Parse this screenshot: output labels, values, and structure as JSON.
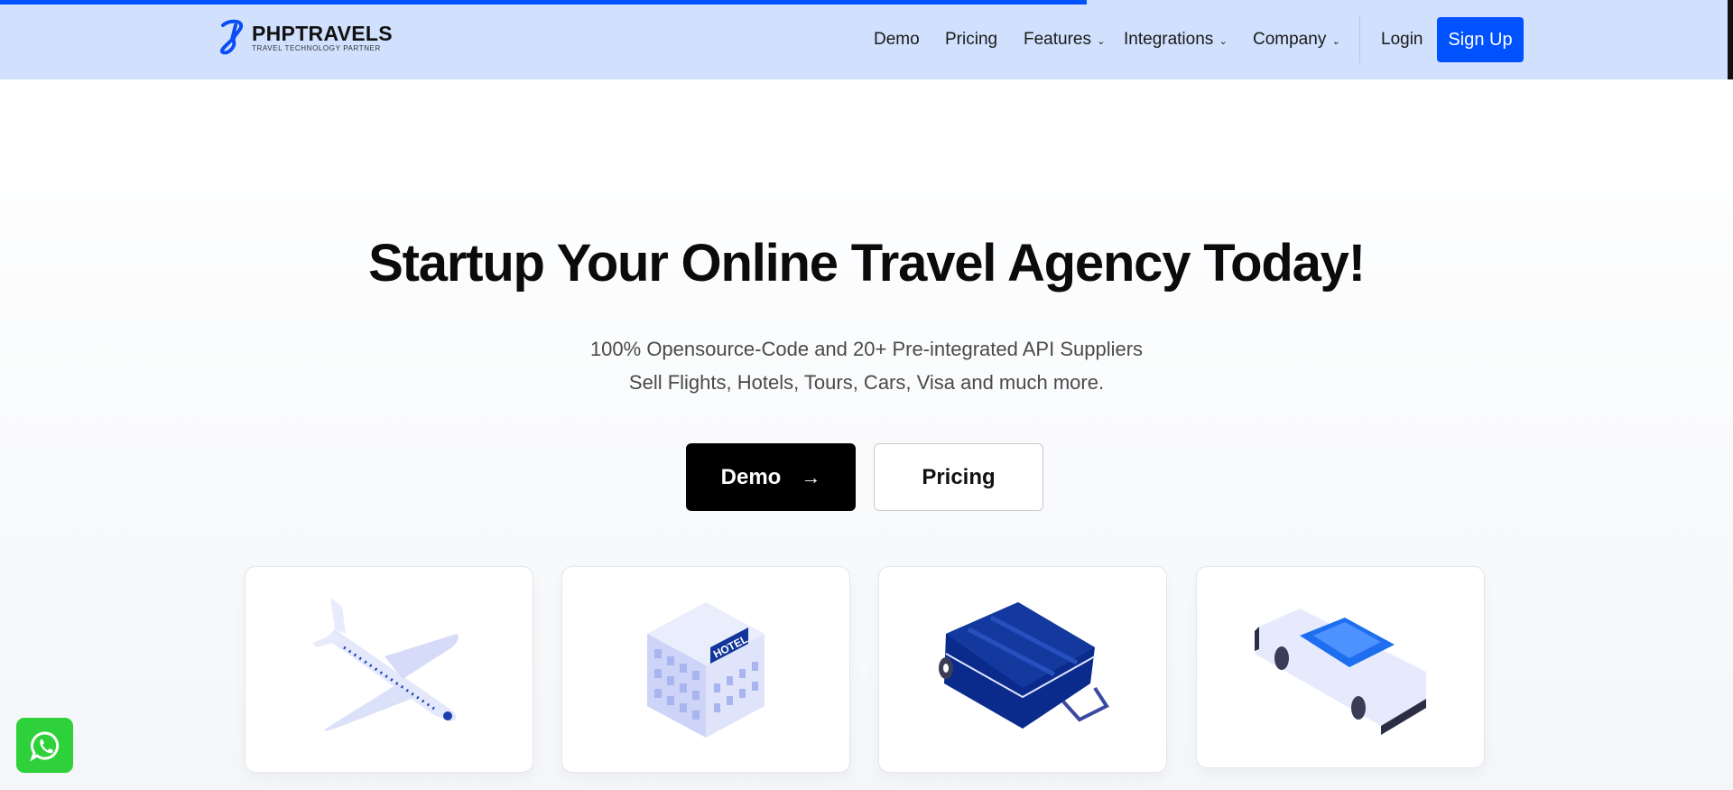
{
  "header": {
    "page_progress_percent": 62.7,
    "logo": {
      "title": "PHPTRAVELS",
      "subtitle": "TRAVEL TECHNOLOGY PARTNER"
    },
    "nav": [
      {
        "label": "Demo"
      },
      {
        "label": "Pricing"
      },
      {
        "label": "Features",
        "dropdown": true
      },
      {
        "label": "Integrations",
        "dropdown": true
      },
      {
        "label": "Company",
        "dropdown": true
      }
    ],
    "login": "Login",
    "signup": "Sign Up"
  },
  "hero": {
    "title": "Startup Your Online Travel Agency Today!",
    "subtitle_line1": "100% Opensource-Code and 20+ Pre-integrated API Suppliers",
    "subtitle_line2": "Sell Flights, Hotels, Tours, Cars, Visa and much more.",
    "demo_button": "Demo",
    "pricing_button": "Pricing",
    "hotel_sign": "HOTEL"
  },
  "cards": [
    {
      "icon": "airplane-icon"
    },
    {
      "icon": "hotel-icon"
    },
    {
      "icon": "suitcase-icon"
    },
    {
      "icon": "car-icon"
    }
  ],
  "colors": {
    "primary": "#0052ff",
    "nav_bg": "#d0e0fd",
    "whatsapp": "#2fd13a"
  }
}
